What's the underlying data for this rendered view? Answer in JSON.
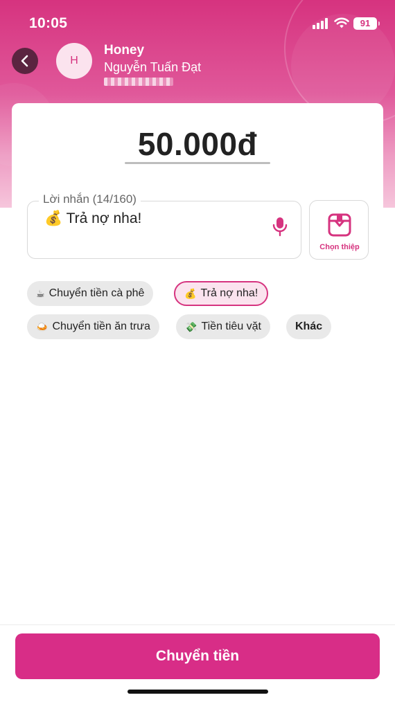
{
  "status_bar": {
    "time": "10:05",
    "battery": "91"
  },
  "header": {
    "avatar_initial": "H",
    "contact_name": "Honey",
    "contact_fullname": "Nguyễn Tuấn Đạt"
  },
  "amount": "50.000đ",
  "message": {
    "label": "Lời nhắn (14/160)",
    "emoji": "💰",
    "text": "Trả nợ nha!"
  },
  "card_picker_label": "Chọn thiệp",
  "suggestions": [
    {
      "emoji": "☕",
      "label": "Chuyển tiền cà phê",
      "selected": false
    },
    {
      "emoji": "💰",
      "label": "Trả nợ nha!",
      "selected": true
    },
    {
      "emoji": "🍛",
      "label": "Chuyển tiền ăn trưa",
      "selected": false
    },
    {
      "emoji": "💸",
      "label": "Tiền tiêu vặt",
      "selected": false
    },
    {
      "emoji": "",
      "label": "Khác",
      "selected": false
    }
  ],
  "cta_label": "Chuyển tiền",
  "colors": {
    "brand": "#d82d87",
    "header_top": "#d6337f",
    "back_button": "#5b2440"
  }
}
